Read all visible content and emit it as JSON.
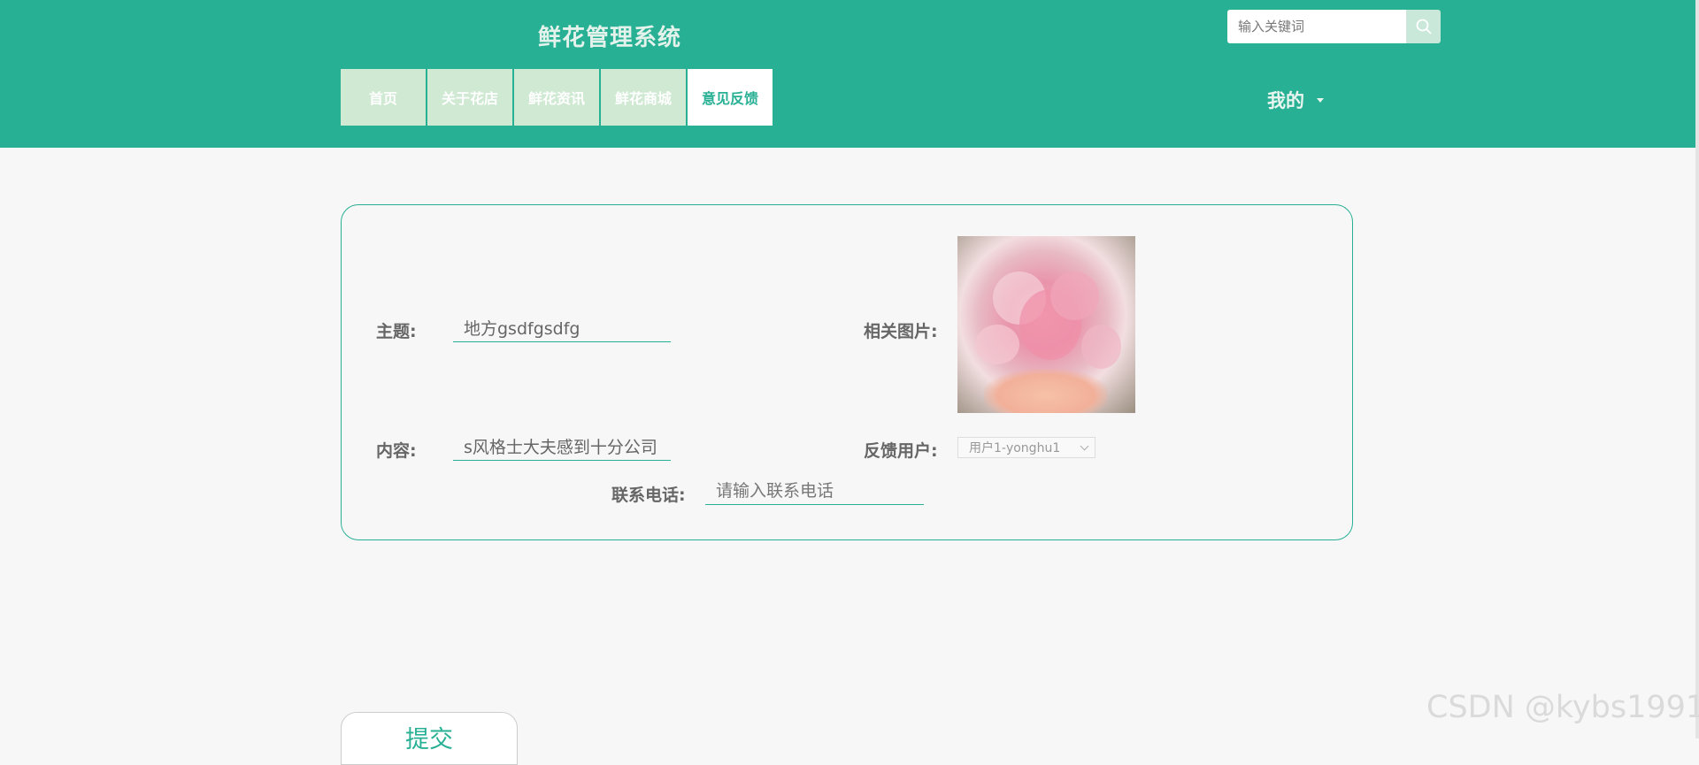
{
  "header": {
    "site_title": "鲜花管理系统",
    "search_placeholder": "输入关键词",
    "user_menu_label": "我的"
  },
  "nav": {
    "items": [
      {
        "label": "首页"
      },
      {
        "label": "关于花店"
      },
      {
        "label": "鲜花资讯"
      },
      {
        "label": "鲜花商城"
      },
      {
        "label": "意见反馈",
        "active": true
      }
    ]
  },
  "form": {
    "subject_label": "主题:",
    "subject_value": "地方gsdfgsdfg",
    "image_label": "相关图片:",
    "content_label": "内容:",
    "content_value": "s风格士大夫感到十分公司",
    "user_label": "反馈用户:",
    "user_selected": "用户1-yonghu1",
    "phone_label": "联系电话:",
    "phone_placeholder": "请输入联系电话",
    "submit_label": "提交"
  },
  "watermark": "CSDN @kybs1991",
  "colors": {
    "primary": "#28b095",
    "nav_inactive": "#cfe9d3",
    "background": "#f7f7f7"
  }
}
